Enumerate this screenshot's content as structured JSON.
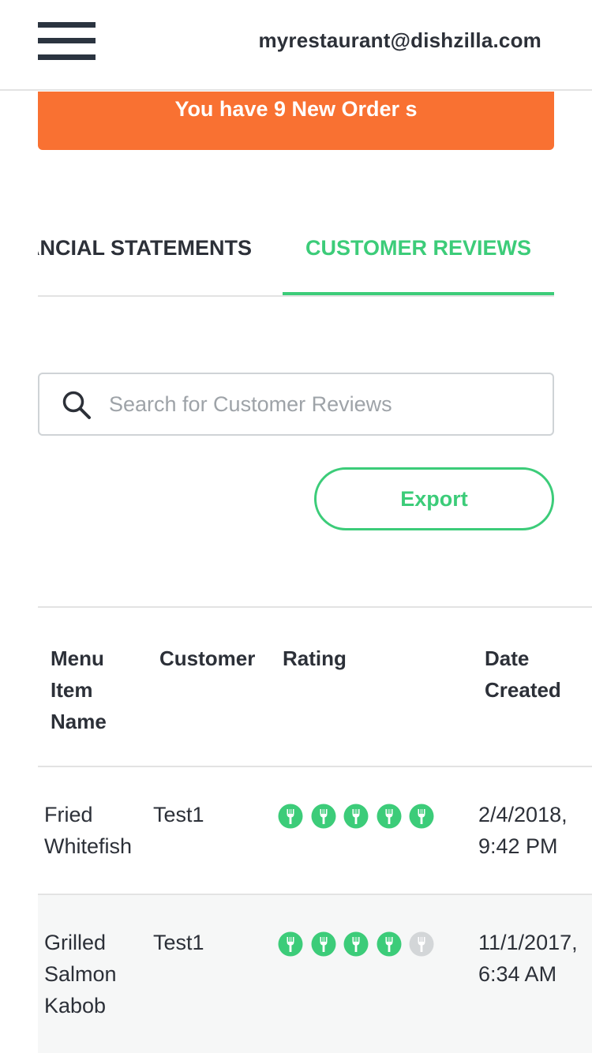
{
  "header": {
    "menu_icon": "hamburger-icon",
    "user_email": "myrestaurant@dishzilla.com"
  },
  "banner": {
    "text": "You have 9 New Order s",
    "color": "#f97132"
  },
  "tabs": [
    {
      "label": "FINANCIAL STATEMENTS",
      "active": false
    },
    {
      "label": "CUSTOMER REVIEWS",
      "active": true
    }
  ],
  "search": {
    "icon": "search-icon",
    "placeholder": "Search for Customer Reviews",
    "value": ""
  },
  "export": {
    "label": "Export"
  },
  "table": {
    "headers": {
      "item": "Menu Item Name",
      "customer": "Customer",
      "rating": "Rating",
      "date": "Date Created"
    },
    "rows": [
      {
        "item": "Fried Whitefish",
        "customer": "Test1",
        "rating": 5,
        "rating_max": 5,
        "date": "2/4/2018, 9:42 PM"
      },
      {
        "item": "Grilled Salmon Kabob",
        "customer": "Test1",
        "rating": 4,
        "rating_max": 5,
        "date": "11/1/2017, 6:34 AM"
      }
    ]
  },
  "colors": {
    "accent": "#3ccc79",
    "rating_off": "#d3d6d8",
    "text": "#2c3038"
  }
}
